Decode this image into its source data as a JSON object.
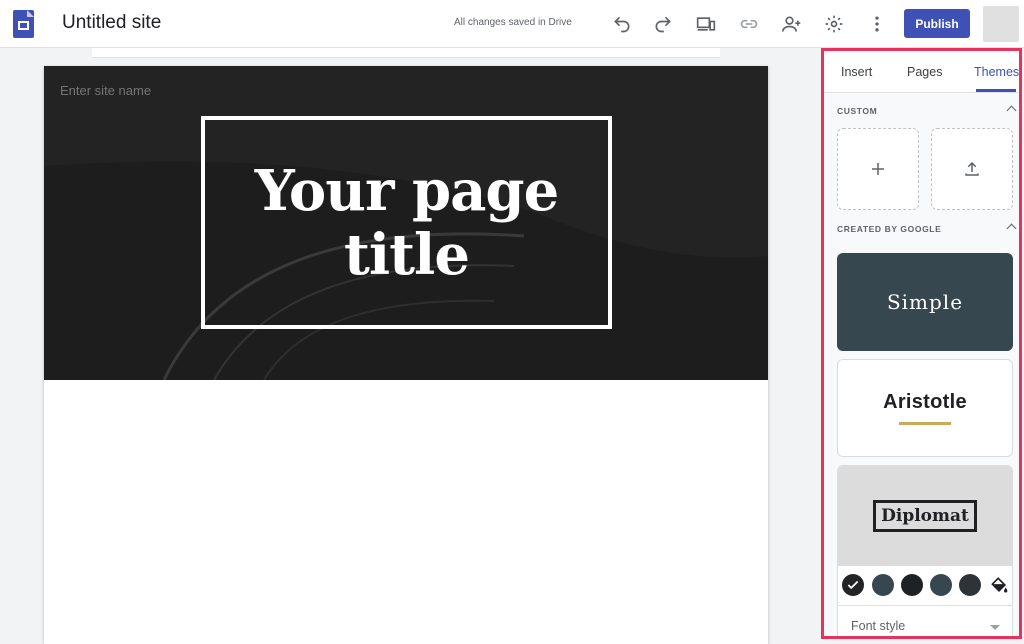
{
  "app": {
    "site_title": "Untitled site",
    "save_status": "All changes saved in Drive",
    "publish_label": "Publish"
  },
  "toolbar": {
    "icons": [
      "undo-icon",
      "redo-icon",
      "preview-devices-icon",
      "link-icon",
      "share-icon",
      "settings-icon",
      "more-vert-icon"
    ]
  },
  "canvas": {
    "site_name_placeholder": "Enter site name",
    "page_title_line1": "Your page",
    "page_title_line2": "title"
  },
  "panel": {
    "tabs": [
      {
        "label": "Insert",
        "active": false
      },
      {
        "label": "Pages",
        "active": false
      },
      {
        "label": "Themes",
        "active": true
      }
    ],
    "custom_label": "CUSTOM",
    "created_by_google_label": "CREATED BY GOOGLE",
    "themes": [
      {
        "name": "Simple"
      },
      {
        "name": "Aristotle"
      },
      {
        "name": "Diplomat"
      }
    ],
    "diplomat_colors": [
      "#222426",
      "#37474f",
      "#202124",
      "#37474f",
      "#2d3338"
    ],
    "selected_color_index": 0,
    "font_style_label": "Font style"
  },
  "colors": {
    "accent": "#3f51b5",
    "highlight_border": "#e8315b",
    "simple_bg": "#37474f",
    "aristotle_underline": "#c9a95a"
  }
}
